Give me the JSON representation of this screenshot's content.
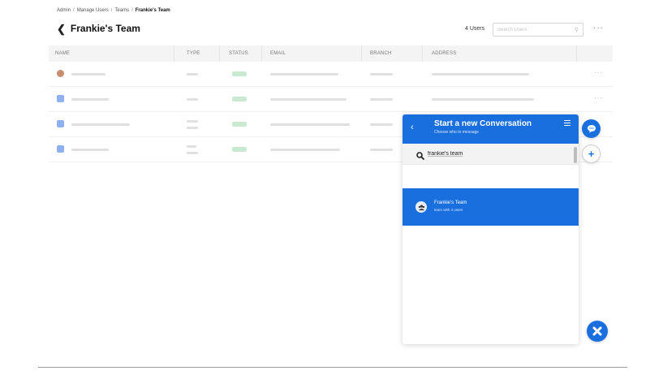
{
  "breadcrumb": [
    "Admin",
    "Manage Users",
    "Teams",
    "Frankie's Team"
  ],
  "breadcrumb_separator": "/",
  "page": {
    "title": "Frankie's Team"
  },
  "toolbar": {
    "user_count": "4 Users",
    "search_placeholder": "Search Users"
  },
  "table": {
    "columns": [
      "NAME",
      "TYPE",
      "STATUS",
      "EMAIL",
      "BRANCH",
      "ADDRESS"
    ],
    "row_count": 4
  },
  "chat_panel": {
    "title": "Start a new Conversation",
    "subtitle": "Choose who to message",
    "search_value": "frankie's team",
    "result": {
      "name": "Frankie's Team",
      "subtitle": "team with 4 users"
    }
  },
  "colors": {
    "accent": "#1a6fde"
  },
  "icons": [
    "chevron-left-icon",
    "search-icon",
    "more-icon",
    "hamburger-icon",
    "chat-bubble-icon",
    "plus-icon",
    "close-icon",
    "team-icon"
  ]
}
